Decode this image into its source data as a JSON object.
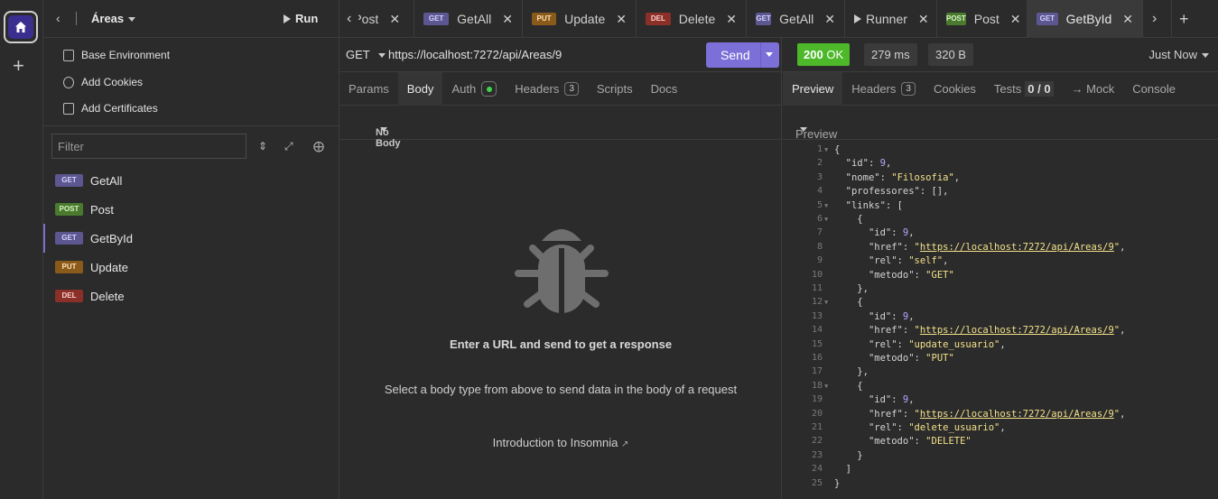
{
  "sidebar": {
    "project": "Áreas",
    "run_label": "Run",
    "items": [
      {
        "label": "Base Environment"
      },
      {
        "label": "Add Cookies"
      },
      {
        "label": "Add Certificates"
      }
    ],
    "filter_placeholder": "Filter",
    "requests": [
      {
        "method": "GET",
        "label": "GetAll"
      },
      {
        "method": "POST",
        "label": "Post"
      },
      {
        "method": "GET",
        "label": "GetById"
      },
      {
        "method": "PUT",
        "label": "Update"
      },
      {
        "method": "DEL",
        "label": "Delete"
      }
    ]
  },
  "tabs": [
    {
      "method": "",
      "label": "Post"
    },
    {
      "method": "GET",
      "label": "GetAll"
    },
    {
      "method": "PUT",
      "label": "Update"
    },
    {
      "method": "DEL",
      "label": "Delete"
    },
    {
      "method": "GET",
      "label": "GetAll"
    },
    {
      "method": "",
      "label": "Runner"
    },
    {
      "method": "POST",
      "label": "Post"
    },
    {
      "method": "GET",
      "label": "GetById"
    }
  ],
  "request": {
    "method": "GET",
    "url": "https://localhost:7272/api/Areas/9",
    "send_label": "Send",
    "subtabs": [
      "Params",
      "Body",
      "Auth",
      "Headers",
      "Scripts",
      "Docs"
    ],
    "headers_count": "3",
    "body_type": "No Body",
    "empty_title": "Enter a URL and send to get a response",
    "empty_hint": "Select a body type from above to send data in the body of a request",
    "intro_link": "Introduction to Insomnia"
  },
  "response": {
    "status_code": "200",
    "status_text": "OK",
    "time": "279 ms",
    "size": "320 B",
    "when": "Just Now",
    "tabs": [
      "Preview",
      "Headers",
      "Cookies",
      "Tests",
      "→ Mock",
      "Console"
    ],
    "headers_count": "3",
    "tests_count": "0 / 0",
    "preview_label": "Preview",
    "lines": [
      "{",
      "  \"id\": 9,",
      "  \"nome\": \"Filosofia\",",
      "  \"professores\": [],",
      "  \"links\": [",
      "    {",
      "      \"id\": 9,",
      "      \"href\": \"https://localhost:7272/api/Areas/9\",",
      "      \"rel\": \"self\",",
      "      \"metodo\": \"GET\"",
      "    },",
      "    {",
      "      \"id\": 9,",
      "      \"href\": \"https://localhost:7272/api/Areas/9\",",
      "      \"rel\": \"update_usuario\",",
      "      \"metodo\": \"PUT\"",
      "    },",
      "    {",
      "      \"id\": 9,",
      "      \"href\": \"https://localhost:7272/api/Areas/9\",",
      "      \"rel\": \"delete_usuario\",",
      "      \"metodo\": \"DELETE\"",
      "    }",
      "  ]",
      "}"
    ]
  },
  "colors": {
    "accent": "#7c70d8",
    "ok": "#4db82a",
    "get": "#5c5791",
    "post": "#4a7a2e",
    "put": "#8a5a1a",
    "del": "#8a3028",
    "string": "#f4e28a",
    "number": "#b9a6ff"
  }
}
